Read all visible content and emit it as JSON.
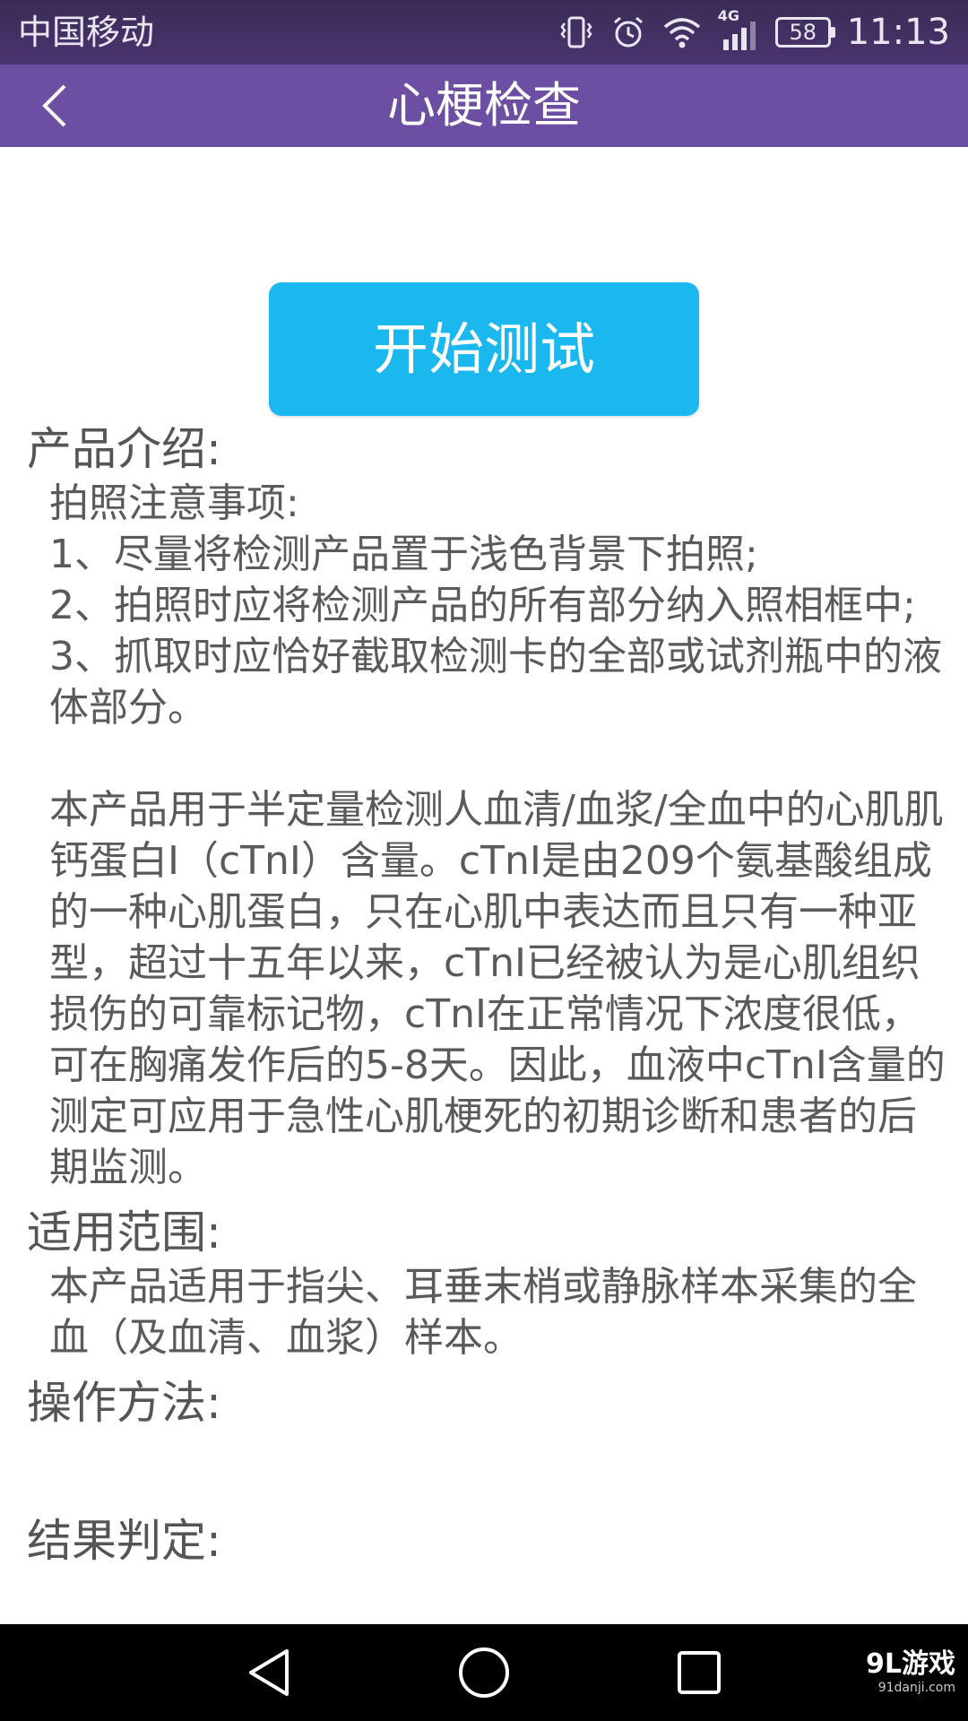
{
  "status_bar": {
    "carrier": "中国移动",
    "network": "4G",
    "battery": "58",
    "time": "11:13"
  },
  "toolbar": {
    "title": "心梗检查",
    "back_icon": "chevron-left-icon"
  },
  "start_button": {
    "label": "开始测试",
    "color": "#1bb7ef"
  },
  "sections": {
    "product_intro": {
      "title": "产品介绍:",
      "photo_notes_title": "拍照注意事项:",
      "note_1": "1、尽量将检测产品置于浅色背景下拍照;",
      "note_2": "2、拍照时应将检测产品的所有部分纳入照相框中;",
      "note_3": "3、抓取时应恰好截取检测卡的全部或试剂瓶中的液体部分。",
      "description": "本产品用于半定量检测人血清/血浆/全血中的心肌肌钙蛋白I（cTnI）含量。cTnI是由209个氨基酸组成的一种心肌蛋白，只在心肌中表达而且只有一种亚型，超过十五年以来，cTnI已经被认为是心肌组织损伤的可靠标记物，cTnI在正常情况下浓度很低，可在胸痛发作后的5-8天。因此，血液中cTnI含量的测定可应用于急性心肌梗死的初期诊断和患者的后期监测。"
    },
    "scope": {
      "title": "适用范围:",
      "text": "本产品适用于指尖、耳垂末梢或静脉样本采集的全血（及血清、血浆）样本。"
    },
    "method": {
      "title": "操作方法:"
    },
    "result": {
      "title": "结果判定:"
    }
  },
  "nav_bar": {
    "back_icon": "triangle-back-icon",
    "home_icon": "circle-home-icon",
    "recent_icon": "square-recent-icon"
  },
  "watermark": {
    "main": "9L游戏",
    "sub": "91danji.com"
  },
  "colors": {
    "toolbar": "#6c4ea3",
    "status_bar": "#3f2e5e",
    "text": "#555555"
  }
}
